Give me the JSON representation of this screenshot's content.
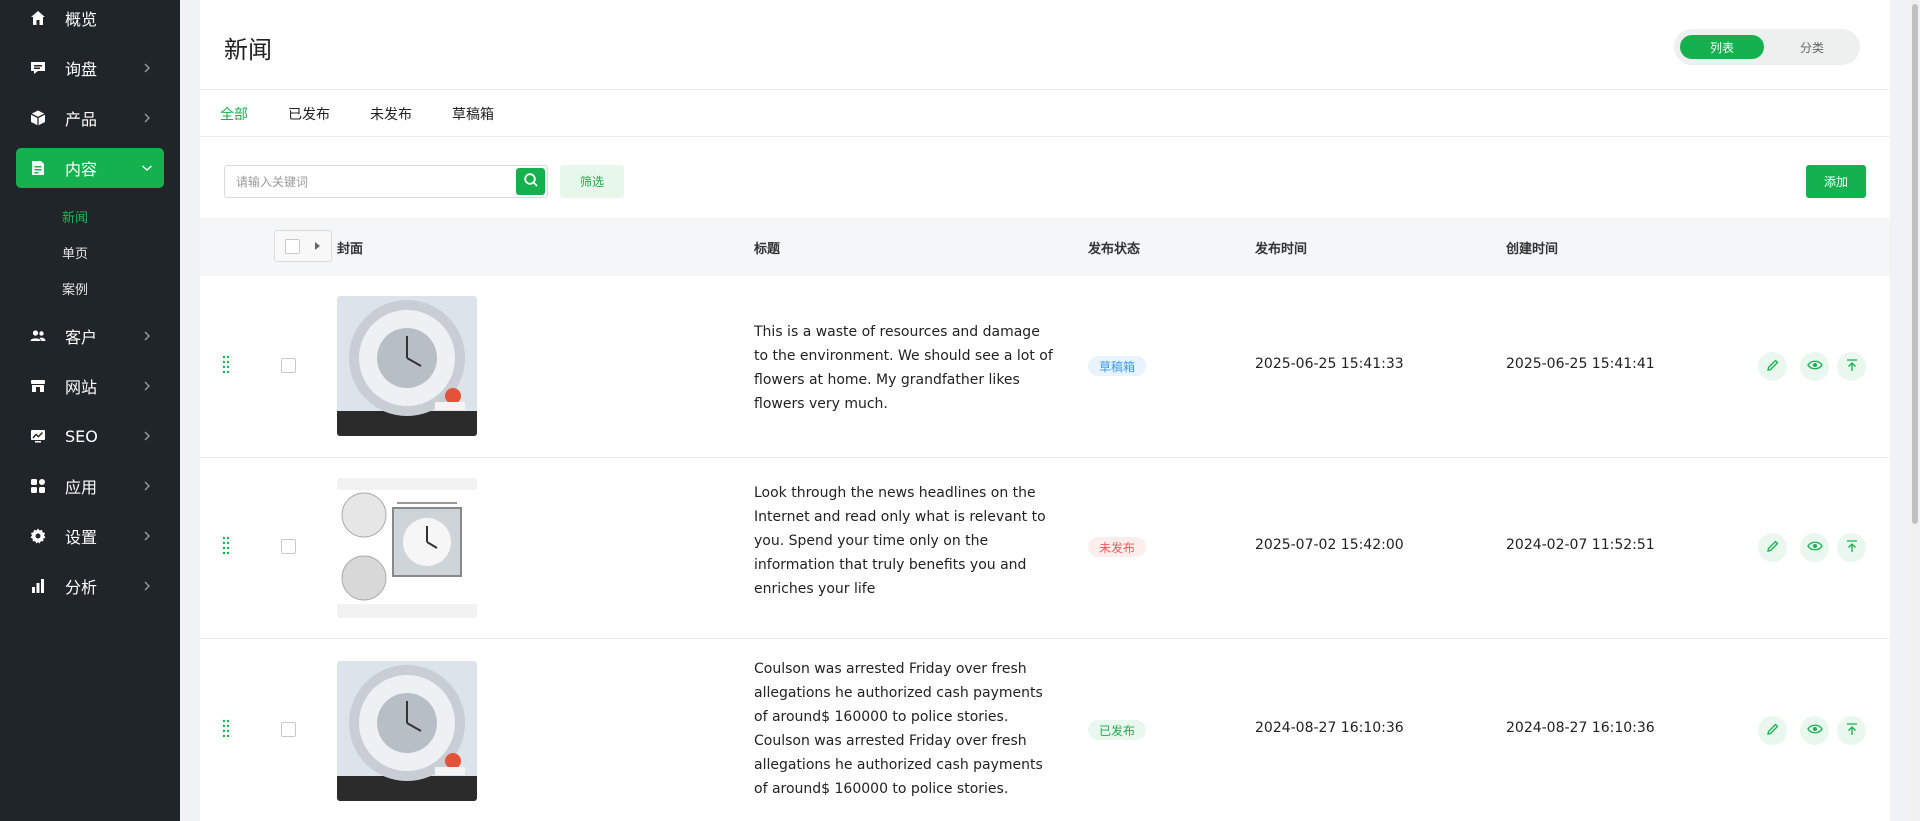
{
  "sidebar": {
    "items": [
      {
        "label": "概览",
        "icon": "home-icon"
      },
      {
        "label": "询盘",
        "icon": "message-icon"
      },
      {
        "label": "产品",
        "icon": "box-icon"
      },
      {
        "label": "内容",
        "icon": "document-icon"
      },
      {
        "label": "客户",
        "icon": "users-icon"
      },
      {
        "label": "网站",
        "icon": "store-icon"
      },
      {
        "label": "SEO",
        "icon": "seo-chart-icon"
      },
      {
        "label": "应用",
        "icon": "apps-icon"
      },
      {
        "label": "设置",
        "icon": "gear-icon"
      },
      {
        "label": "分析",
        "icon": "bar-chart-icon"
      }
    ],
    "active_item": "内容",
    "sub_items": [
      {
        "label": "新闻"
      },
      {
        "label": "单页"
      },
      {
        "label": "案例"
      }
    ],
    "active_sub_item": "新闻"
  },
  "header": {
    "title": "新闻",
    "view_toggle": [
      "列表",
      "分类"
    ],
    "active_view": "列表"
  },
  "tabs": [
    "全部",
    "已发布",
    "未发布",
    "草稿箱"
  ],
  "active_tab": "全部",
  "toolbar": {
    "search_placeholder": "请输入关键词",
    "filter_label": "筛选",
    "add_label": "添加"
  },
  "table": {
    "columns": [
      "封面",
      "标题",
      "发布状态",
      "发布时间",
      "创建时间"
    ],
    "rows": [
      {
        "cover": "wall-clock-image",
        "title": "This is a waste of resources and damage to the environment. We should see a lot of flowers at home. My grandfather likes flowers very much.",
        "status": "草稿箱",
        "publish_time": "2025-06-25 15:41:33",
        "create_time": "2025-06-25 15:41:41"
      },
      {
        "cover": "clock-dimensions-image",
        "title": "Look through the news headlines on the Internet and read only what is relevant to you. Spend your time only on the information that truly benefits you and enriches your life",
        "status": "未发布",
        "publish_time": "2025-07-02 15:42:00",
        "create_time": "2024-02-07 11:52:51"
      },
      {
        "cover": "wall-clock-image",
        "title": "Coulson was arrested Friday over fresh allegations he authorized cash payments of around$ 160000 to police stories. Coulson was arrested Friday over fresh allegations he authorized cash payments of around$ 160000 to police stories.",
        "status": "已发布",
        "publish_time": "2024-08-27 16:10:36",
        "create_time": "2024-08-27 16:10:36"
      }
    ]
  },
  "colors": {
    "accent": "#15b14f",
    "sidebar_bg": "#202529",
    "status_draft": "#3a9bf0",
    "status_unpublished": "#f05a5a",
    "status_published": "#15b14f"
  }
}
